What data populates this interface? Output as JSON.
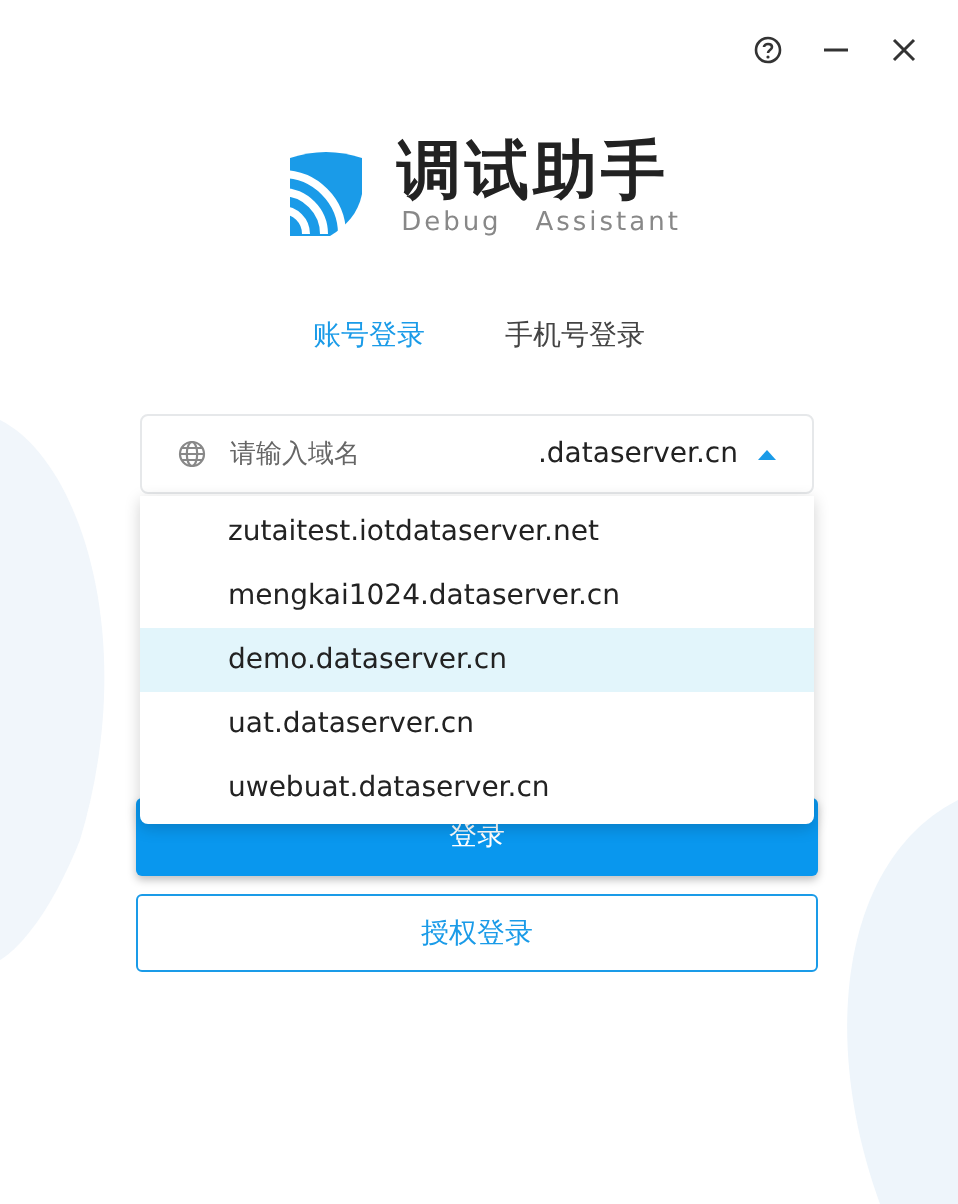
{
  "window": {
    "controls": [
      {
        "kind": "help"
      },
      {
        "kind": "minimize"
      },
      {
        "kind": "close"
      }
    ]
  },
  "brand": {
    "title": "调试助手",
    "subtitle": "Debug   Assistant"
  },
  "tabs": [
    {
      "label": "账号登录",
      "selected": true
    },
    {
      "label": "手机号登录",
      "selected": false
    }
  ],
  "domain": {
    "placeholder": "请输入域名",
    "suffix": ".dataserver.cn",
    "expanded": true
  },
  "options": [
    {
      "label": "zutaitest.iotdataserver.net",
      "selected": false
    },
    {
      "label": "mengkai1024.dataserver.cn",
      "selected": false
    },
    {
      "label": "demo.dataserver.cn",
      "selected": true
    },
    {
      "label": "uat.dataserver.cn",
      "selected": false
    },
    {
      "label": "uwebuat.dataserver.cn",
      "selected": false
    }
  ],
  "buttons": [
    {
      "label": "登录",
      "kind": "primary"
    },
    {
      "label": "授权登录",
      "kind": "outline"
    }
  ]
}
